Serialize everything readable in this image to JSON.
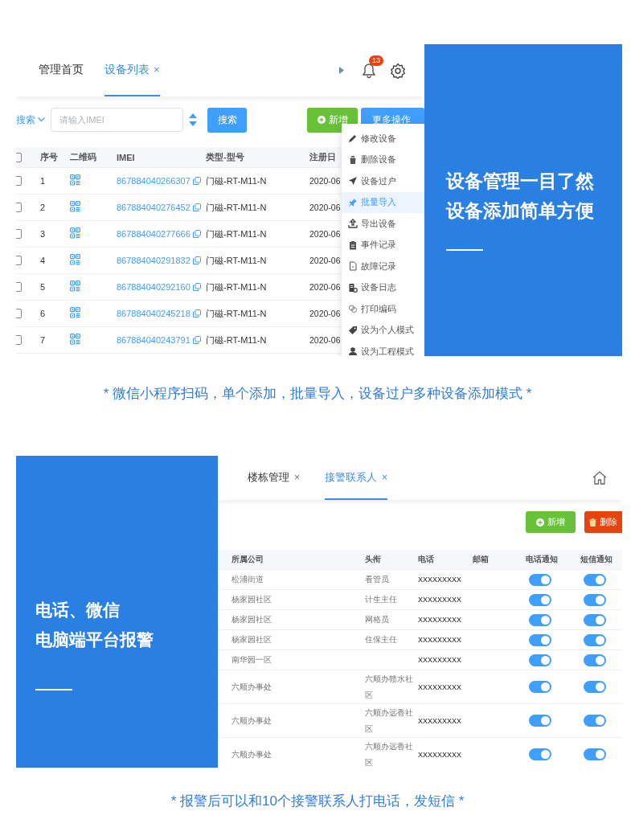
{
  "device_section": {
    "tabs": [
      {
        "label": "管理首页",
        "selected": false
      },
      {
        "label": "设备列表",
        "close": "×",
        "selected": true
      }
    ],
    "notification_count": "13",
    "search_mode": "搜索",
    "imei_field": {
      "placeholder": "请输入IMEI"
    },
    "search_button": "搜索",
    "add_button": "新增",
    "more_button": "更多操作",
    "header_checked": false,
    "columns": [
      "序号",
      "二维码",
      "IMEI",
      "类型-型号",
      "注册日"
    ],
    "rows": [
      {
        "checked": false,
        "index": "1",
        "imei": "867884040266307",
        "model": "门磁-RT-M11-N",
        "date": "2020-06"
      },
      {
        "checked": false,
        "index": "2",
        "imei": "867884040276452",
        "model": "门磁-RT-M11-N",
        "date": "2020-06"
      },
      {
        "checked": false,
        "index": "3",
        "imei": "867884040277666",
        "model": "门磁-RT-M11-N",
        "date": "2020-06"
      },
      {
        "checked": false,
        "index": "4",
        "imei": "867884040291832",
        "model": "门磁-RT-M11-N",
        "date": "2020-06"
      },
      {
        "checked": false,
        "index": "5",
        "imei": "867884040292160",
        "model": "门磁-RT-M11-N",
        "date": "2020-06"
      },
      {
        "checked": false,
        "index": "6",
        "imei": "867884040245218",
        "model": "门磁-RT-M11-N",
        "date": "2020-06"
      },
      {
        "checked": false,
        "index": "7",
        "imei": "867884040243791",
        "model": "门磁-RT-M11-N",
        "date": "2020-06"
      }
    ],
    "menu": [
      {
        "label": "修改设备",
        "selected": false
      },
      {
        "label": "删除设备",
        "selected": false
      },
      {
        "label": "设备过户",
        "selected": false
      },
      {
        "label": "批量导入",
        "selected": true
      },
      {
        "label": "导出设备",
        "selected": false
      },
      {
        "label": "事件记录",
        "selected": false
      },
      {
        "label": "故障记录",
        "selected": false
      },
      {
        "label": "设备日志",
        "selected": false
      },
      {
        "label": "打印编码",
        "selected": false
      },
      {
        "label": "设为个人模式",
        "selected": false
      },
      {
        "label": "设为工程模式",
        "selected": false
      }
    ],
    "promo": {
      "lines": [
        "设备管理一目了然",
        "设备添加简单方便"
      ]
    }
  },
  "caption_1": "* 微信小程序扫码，单个添加，批量导入，设备过户多种设备添加模式 *",
  "contact_section": {
    "promo": {
      "lines": [
        "电话、微信",
        "电脑端平台报警"
      ]
    },
    "tabs": [
      {
        "label": "楼栋管理",
        "close": "×",
        "selected": false
      },
      {
        "label": "接警联系人",
        "close": "×",
        "selected": true
      }
    ],
    "add_button": "新增",
    "delete_button": "删除",
    "columns": [
      "所属公司",
      "头衔",
      "电话",
      "邮箱",
      "电话通知",
      "短信通知"
    ],
    "rows": [
      {
        "company": "松浦街道",
        "title": "看管员",
        "phone": "XXXXXXXXX",
        "call_notify": true,
        "sms_notify": true
      },
      {
        "company": "杨家园社区",
        "title": "计生主任",
        "phone": "XXXXXXXXX",
        "call_notify": true,
        "sms_notify": true
      },
      {
        "company": "杨家园社区",
        "title": "网格员",
        "phone": "XXXXXXXXX",
        "call_notify": true,
        "sms_notify": true
      },
      {
        "company": "杨家园社区",
        "title": "住保主任",
        "phone": "XXXXXXXXX",
        "call_notify": true,
        "sms_notify": true
      },
      {
        "company": "南华园一区",
        "phone": "XXXXXXXXX",
        "call_notify": true,
        "sms_notify": true
      },
      {
        "company": "六顺办事处",
        "title": "六顺办赣水社区",
        "phone": "XXXXXXXXX",
        "call_notify": true,
        "sms_notify": true
      },
      {
        "company": "六顺办事处",
        "title": "六顺办远香社区",
        "phone": "XXXXXXXXX",
        "call_notify": true,
        "sms_notify": true
      },
      {
        "company": "六顺办事处",
        "title": "六顺办远香社区",
        "phone": "XXXXXXXXX",
        "call_notify": true,
        "sms_notify": true
      }
    ]
  },
  "caption_2": "* 报警后可以和10个接警联系人打电话，发短信 *"
}
